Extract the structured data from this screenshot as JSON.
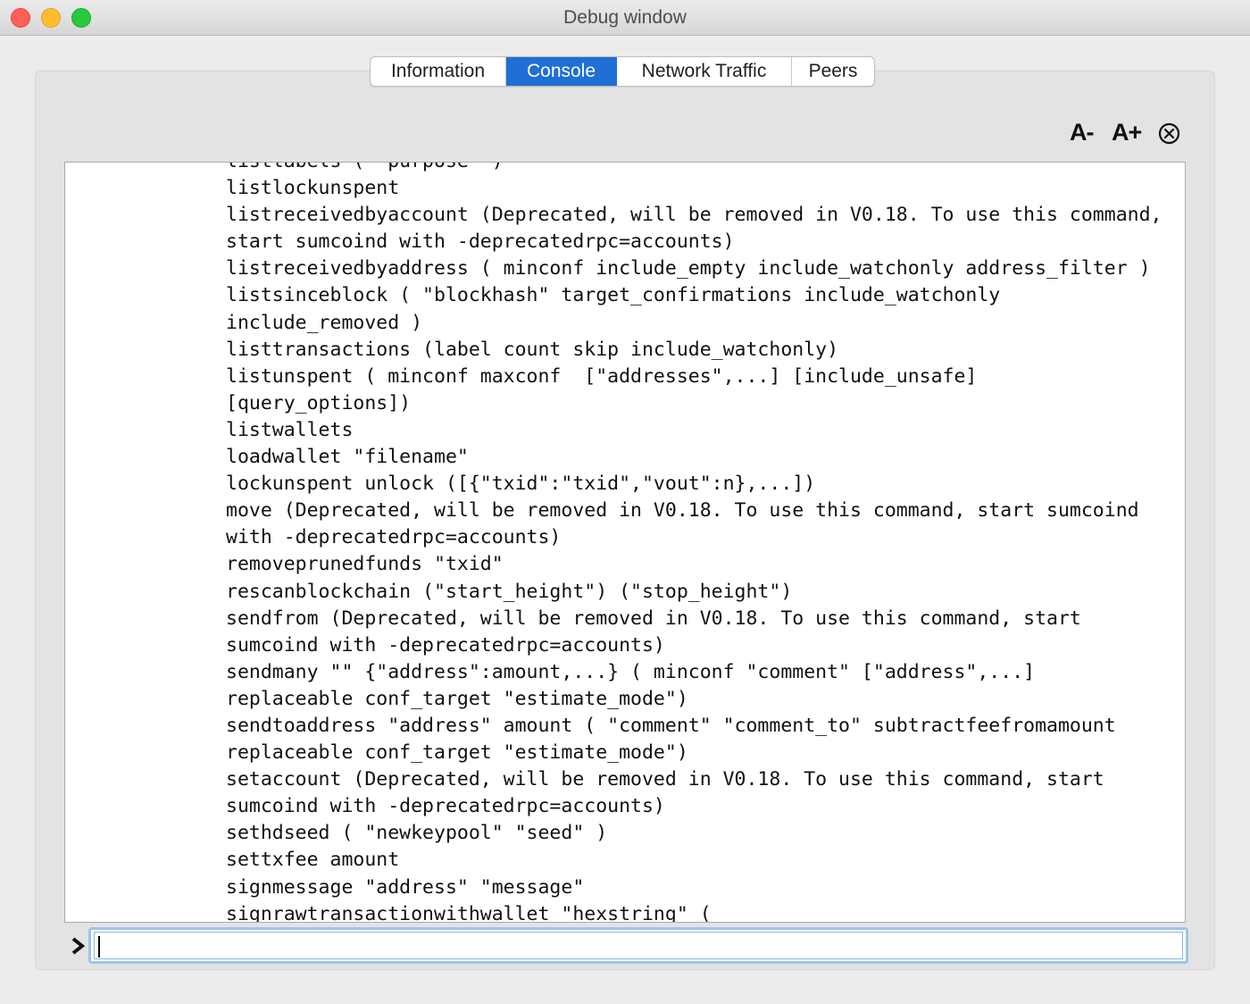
{
  "window": {
    "title": "Debug window"
  },
  "tabs": [
    {
      "label": "Information"
    },
    {
      "label": "Console"
    },
    {
      "label": "Network Traffic"
    },
    {
      "label": "Peers"
    }
  ],
  "toolbar": {
    "font_decrease_label": "A-",
    "font_increase_label": "A+"
  },
  "console": {
    "lines": [
      "listlabels ( \"purpose\" )",
      "listlockunspent",
      "listreceivedbyaccount (Deprecated, will be removed in V0.18. To use this command,",
      "start sumcoind with -deprecatedrpc=accounts)",
      "listreceivedbyaddress ( minconf include_empty include_watchonly address_filter )",
      "listsinceblock ( \"blockhash\" target_confirmations include_watchonly",
      "include_removed )",
      "listtransactions (label count skip include_watchonly)",
      "listunspent ( minconf maxconf  [\"addresses\",...] [include_unsafe]",
      "[query_options])",
      "listwallets",
      "loadwallet \"filename\"",
      "lockunspent unlock ([{\"txid\":\"txid\",\"vout\":n},...])",
      "move (Deprecated, will be removed in V0.18. To use this command, start sumcoind",
      "with -deprecatedrpc=accounts)",
      "removeprunedfunds \"txid\"",
      "rescanblockchain (\"start_height\") (\"stop_height\")",
      "sendfrom (Deprecated, will be removed in V0.18. To use this command, start",
      "sumcoind with -deprecatedrpc=accounts)",
      "sendmany \"\" {\"address\":amount,...} ( minconf \"comment\" [\"address\",...]",
      "replaceable conf_target \"estimate_mode\")",
      "sendtoaddress \"address\" amount ( \"comment\" \"comment_to\" subtractfeefromamount",
      "replaceable conf_target \"estimate_mode\")",
      "setaccount (Deprecated, will be removed in V0.18. To use this command, start",
      "sumcoind with -deprecatedrpc=accounts)",
      "sethdseed ( \"newkeypool\" \"seed\" )",
      "settxfee amount",
      "signmessage \"address\" \"message\"",
      "signrawtransactionwithwallet \"hexstring\" ("
    ],
    "input_value": ""
  },
  "colors": {
    "active_tab": "#1f6fd6",
    "input_focus_ring": "#9cc4ea",
    "close_button": "#fe5f57",
    "minimize_button": "#febc2e",
    "maximize_button": "#28c840"
  },
  "icons": {
    "clear": "clear-console-icon",
    "prompt": "prompt-chevron-icon"
  }
}
